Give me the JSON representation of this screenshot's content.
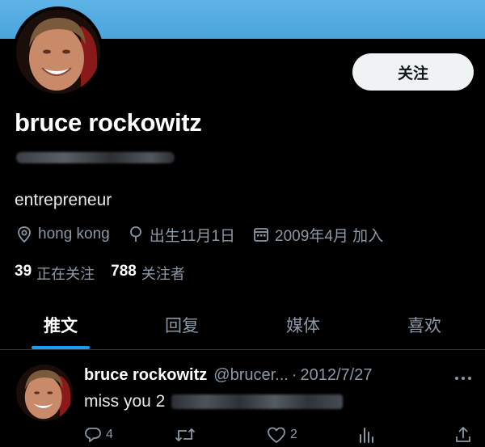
{
  "profile": {
    "display_name": "bruce rockowitz",
    "bio": "entrepreneur",
    "follow_label": "关注",
    "meta": {
      "location": "hong kong",
      "birthday": "出生11月1日",
      "joined": "2009年4月 加入"
    },
    "following_count": "39",
    "following_label": "正在关注",
    "followers_count": "788",
    "followers_label": "关注者"
  },
  "tabs": [
    {
      "label": "推文",
      "active": true
    },
    {
      "label": "回复",
      "active": false
    },
    {
      "label": "媒体",
      "active": false
    },
    {
      "label": "喜欢",
      "active": false
    }
  ],
  "tweet": {
    "name": "bruce rockowitz",
    "handle": "@brucer...",
    "separator": "·",
    "date": "2012/7/27",
    "text": "miss you 2",
    "reply_count": "4",
    "like_count": "2"
  },
  "colors": {
    "banner": "#4aa4dc",
    "accent": "#1d9bf0",
    "background": "#000000",
    "secondary_text": "#8b98a5"
  },
  "icons": [
    "location-icon",
    "birthday-icon",
    "calendar-icon",
    "reply-icon",
    "retweet-icon",
    "like-icon",
    "views-icon",
    "share-icon",
    "more-icon"
  ]
}
